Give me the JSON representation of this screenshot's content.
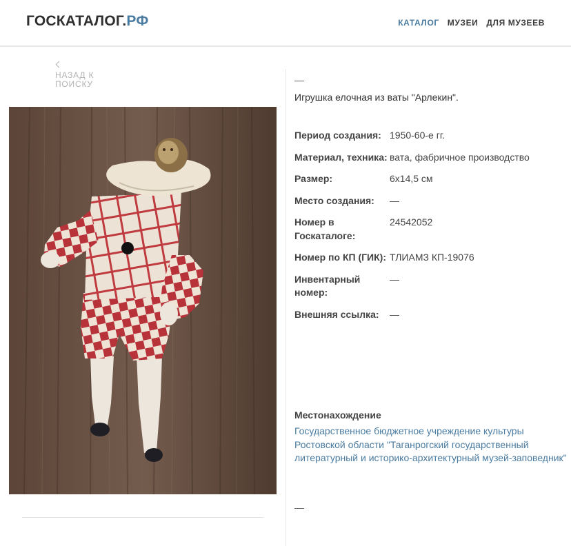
{
  "header": {
    "logo_base": "ГОСКАТАЛОГ.",
    "logo_tld": "РФ",
    "nav": [
      "КАТАЛОГ",
      "МУЗЕИ",
      "ДЛЯ МУЗЕЕВ"
    ],
    "active_nav": "КАТАЛОГ",
    "accent_color": "#4a7ba0"
  },
  "back": {
    "label_line1": "НАЗАД К",
    "label_line2": "ПОИСКУ"
  },
  "item": {
    "dash_top": "—",
    "title": "Игрушка елочная из ваты \"Арлекин\".",
    "properties": [
      {
        "label": "Период создания:",
        "value": "1950-60-е гг."
      },
      {
        "label": "Материал, техника:",
        "value": "вата, фабричное производство"
      },
      {
        "label": "Размер:",
        "value": "6х14,5 см"
      },
      {
        "label": "Место создания:",
        "value": "—"
      },
      {
        "label": "Номер в Госкаталоге:",
        "value": "24542052"
      },
      {
        "label": "Номер по КП (ГИК):",
        "value": "ТЛИАМЗ КП-19076"
      },
      {
        "label": "Инвентарный номер:",
        "value": "—"
      },
      {
        "label": "Внешняя ссылка:",
        "value": "—"
      }
    ],
    "location_label": "Местонахождение",
    "location_value": "Государственное бюджетное учреждение культуры Ростовской области \"Таганрогский государственный литературный и историко-архитектурный музей-заповедник\"",
    "dash_bottom": "—"
  }
}
